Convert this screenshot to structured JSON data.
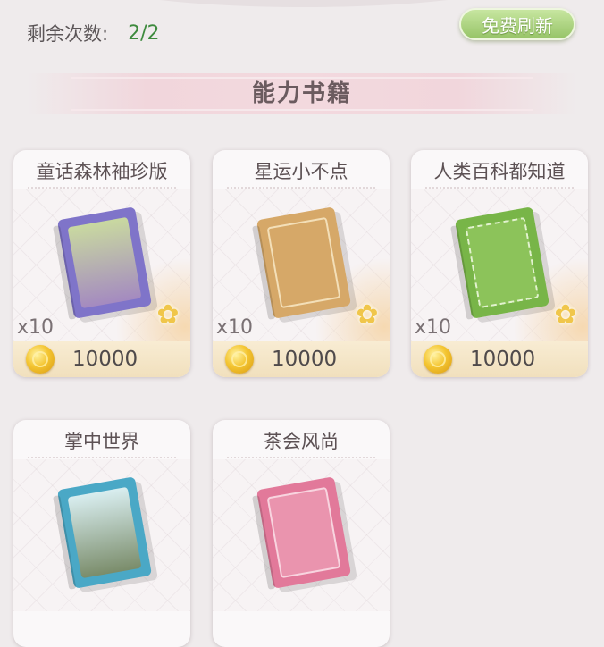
{
  "header": {
    "remaining_label": "剩余次数:",
    "remaining_value": "2/2",
    "refresh_button": "免费刷新"
  },
  "section": {
    "title": "能力书籍"
  },
  "items": [
    {
      "name": "童话森林袖珍版",
      "quantity": "x10",
      "price": "10000",
      "icon": "fairy-tale-book-icon",
      "book_color": "#7f74c9"
    },
    {
      "name": "星运小不点",
      "quantity": "x10",
      "price": "10000",
      "icon": "star-luck-book-icon",
      "book_color": "#d6a868"
    },
    {
      "name": "人类百科都知道",
      "quantity": "x10",
      "price": "10000",
      "icon": "encyclopedia-book-icon",
      "book_color": "#78b548"
    },
    {
      "name": "掌中世界",
      "icon": "palm-world-book-icon",
      "book_color": "#4aa8c6"
    },
    {
      "name": "茶会风尚",
      "icon": "tea-party-book-icon",
      "book_color": "#e2799a"
    }
  ],
  "colors": {
    "background": "#efebec",
    "refresh_button": "#a9d27c",
    "remaining_value": "#3d8a3d",
    "coin": "#f4c531"
  }
}
